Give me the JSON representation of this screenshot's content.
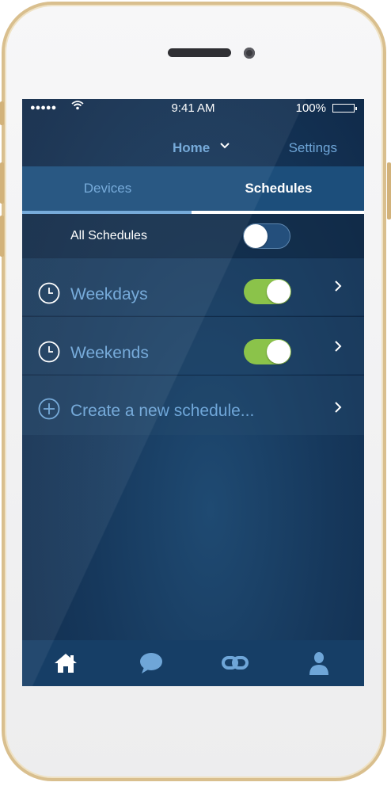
{
  "status_bar": {
    "signal": "●●●●●",
    "time": "9:41 AM",
    "battery": "100%"
  },
  "nav": {
    "title": "Home",
    "settings_label": "Settings"
  },
  "tabs": {
    "devices_label": "Devices",
    "schedules_label": "Schedules",
    "active": "Schedules"
  },
  "all_schedules": {
    "label": "All Schedules",
    "enabled": false
  },
  "schedules": [
    {
      "name": "Weekdays",
      "enabled": true,
      "icon": "clock-icon"
    },
    {
      "name": "Weekends",
      "enabled": true,
      "icon": "clock-icon"
    }
  ],
  "create": {
    "label": "Create a new schedule...",
    "icon": "plus-circle-icon"
  },
  "bottom_tabs": [
    {
      "name": "home",
      "icon": "house-icon"
    },
    {
      "name": "messages",
      "icon": "chat-bubble-icon"
    },
    {
      "name": "links",
      "icon": "link-icon"
    },
    {
      "name": "profile",
      "icon": "person-icon"
    }
  ],
  "colors": {
    "accent_blue": "#6fa6d8",
    "toggle_on": "#8bc34a",
    "frame_gold": "#d9bf8e"
  }
}
